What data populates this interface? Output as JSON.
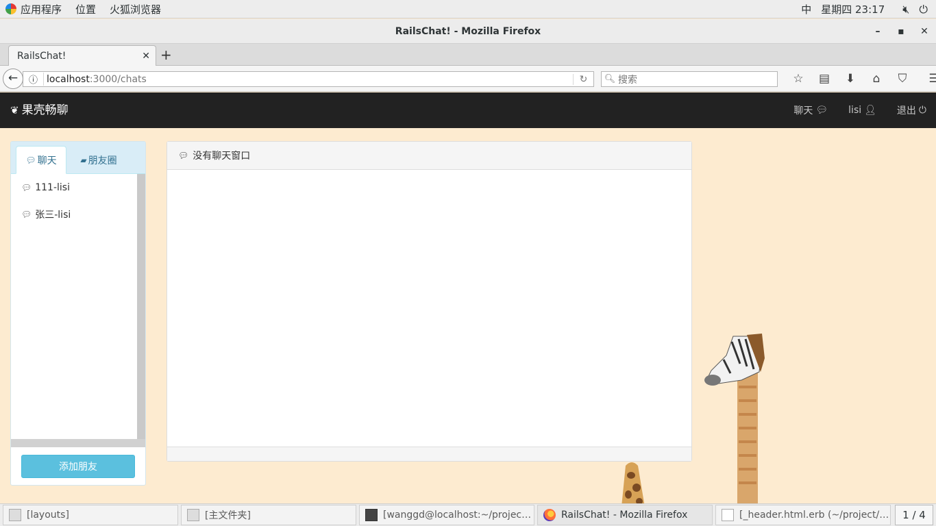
{
  "system_bar": {
    "menu_apps": "应用程序",
    "menu_places": "位置",
    "menu_firefox": "火狐浏览器",
    "input_method": "中",
    "clock": "星期四 23:17"
  },
  "window": {
    "title": "RailsChat! - Mozilla Firefox"
  },
  "browser": {
    "tab_title": "RailsChat!",
    "url_host": "localhost",
    "url_path": ":3000/chats",
    "search_placeholder": "搜索"
  },
  "site": {
    "brand": "果壳畅聊",
    "nav": {
      "chat": "聊天",
      "user": "lisi",
      "logout": "退出"
    },
    "sidebar": {
      "tab_chat": "聊天",
      "tab_moments": "朋友圈",
      "friends": [
        {
          "name": "111-lisi"
        },
        {
          "name": "张三-lisi"
        }
      ],
      "add_button": "添加朋友"
    },
    "chat_panel": {
      "header": "没有聊天窗口"
    }
  },
  "taskbar": {
    "items": [
      {
        "label": "[layouts]"
      },
      {
        "label": "[主文件夹]"
      },
      {
        "label": "[wanggd@localhost:~/project/Rails…"
      },
      {
        "label": "RailsChat! - Mozilla Firefox"
      },
      {
        "label": "[_header.html.erb (~/project/RailsC…"
      }
    ],
    "workspace": "1 / 4"
  },
  "colors": {
    "page_background": "#fdebd0",
    "navbar_background": "#222222",
    "accent_info": "#5bc0de",
    "tab_background": "#d9edf7"
  }
}
